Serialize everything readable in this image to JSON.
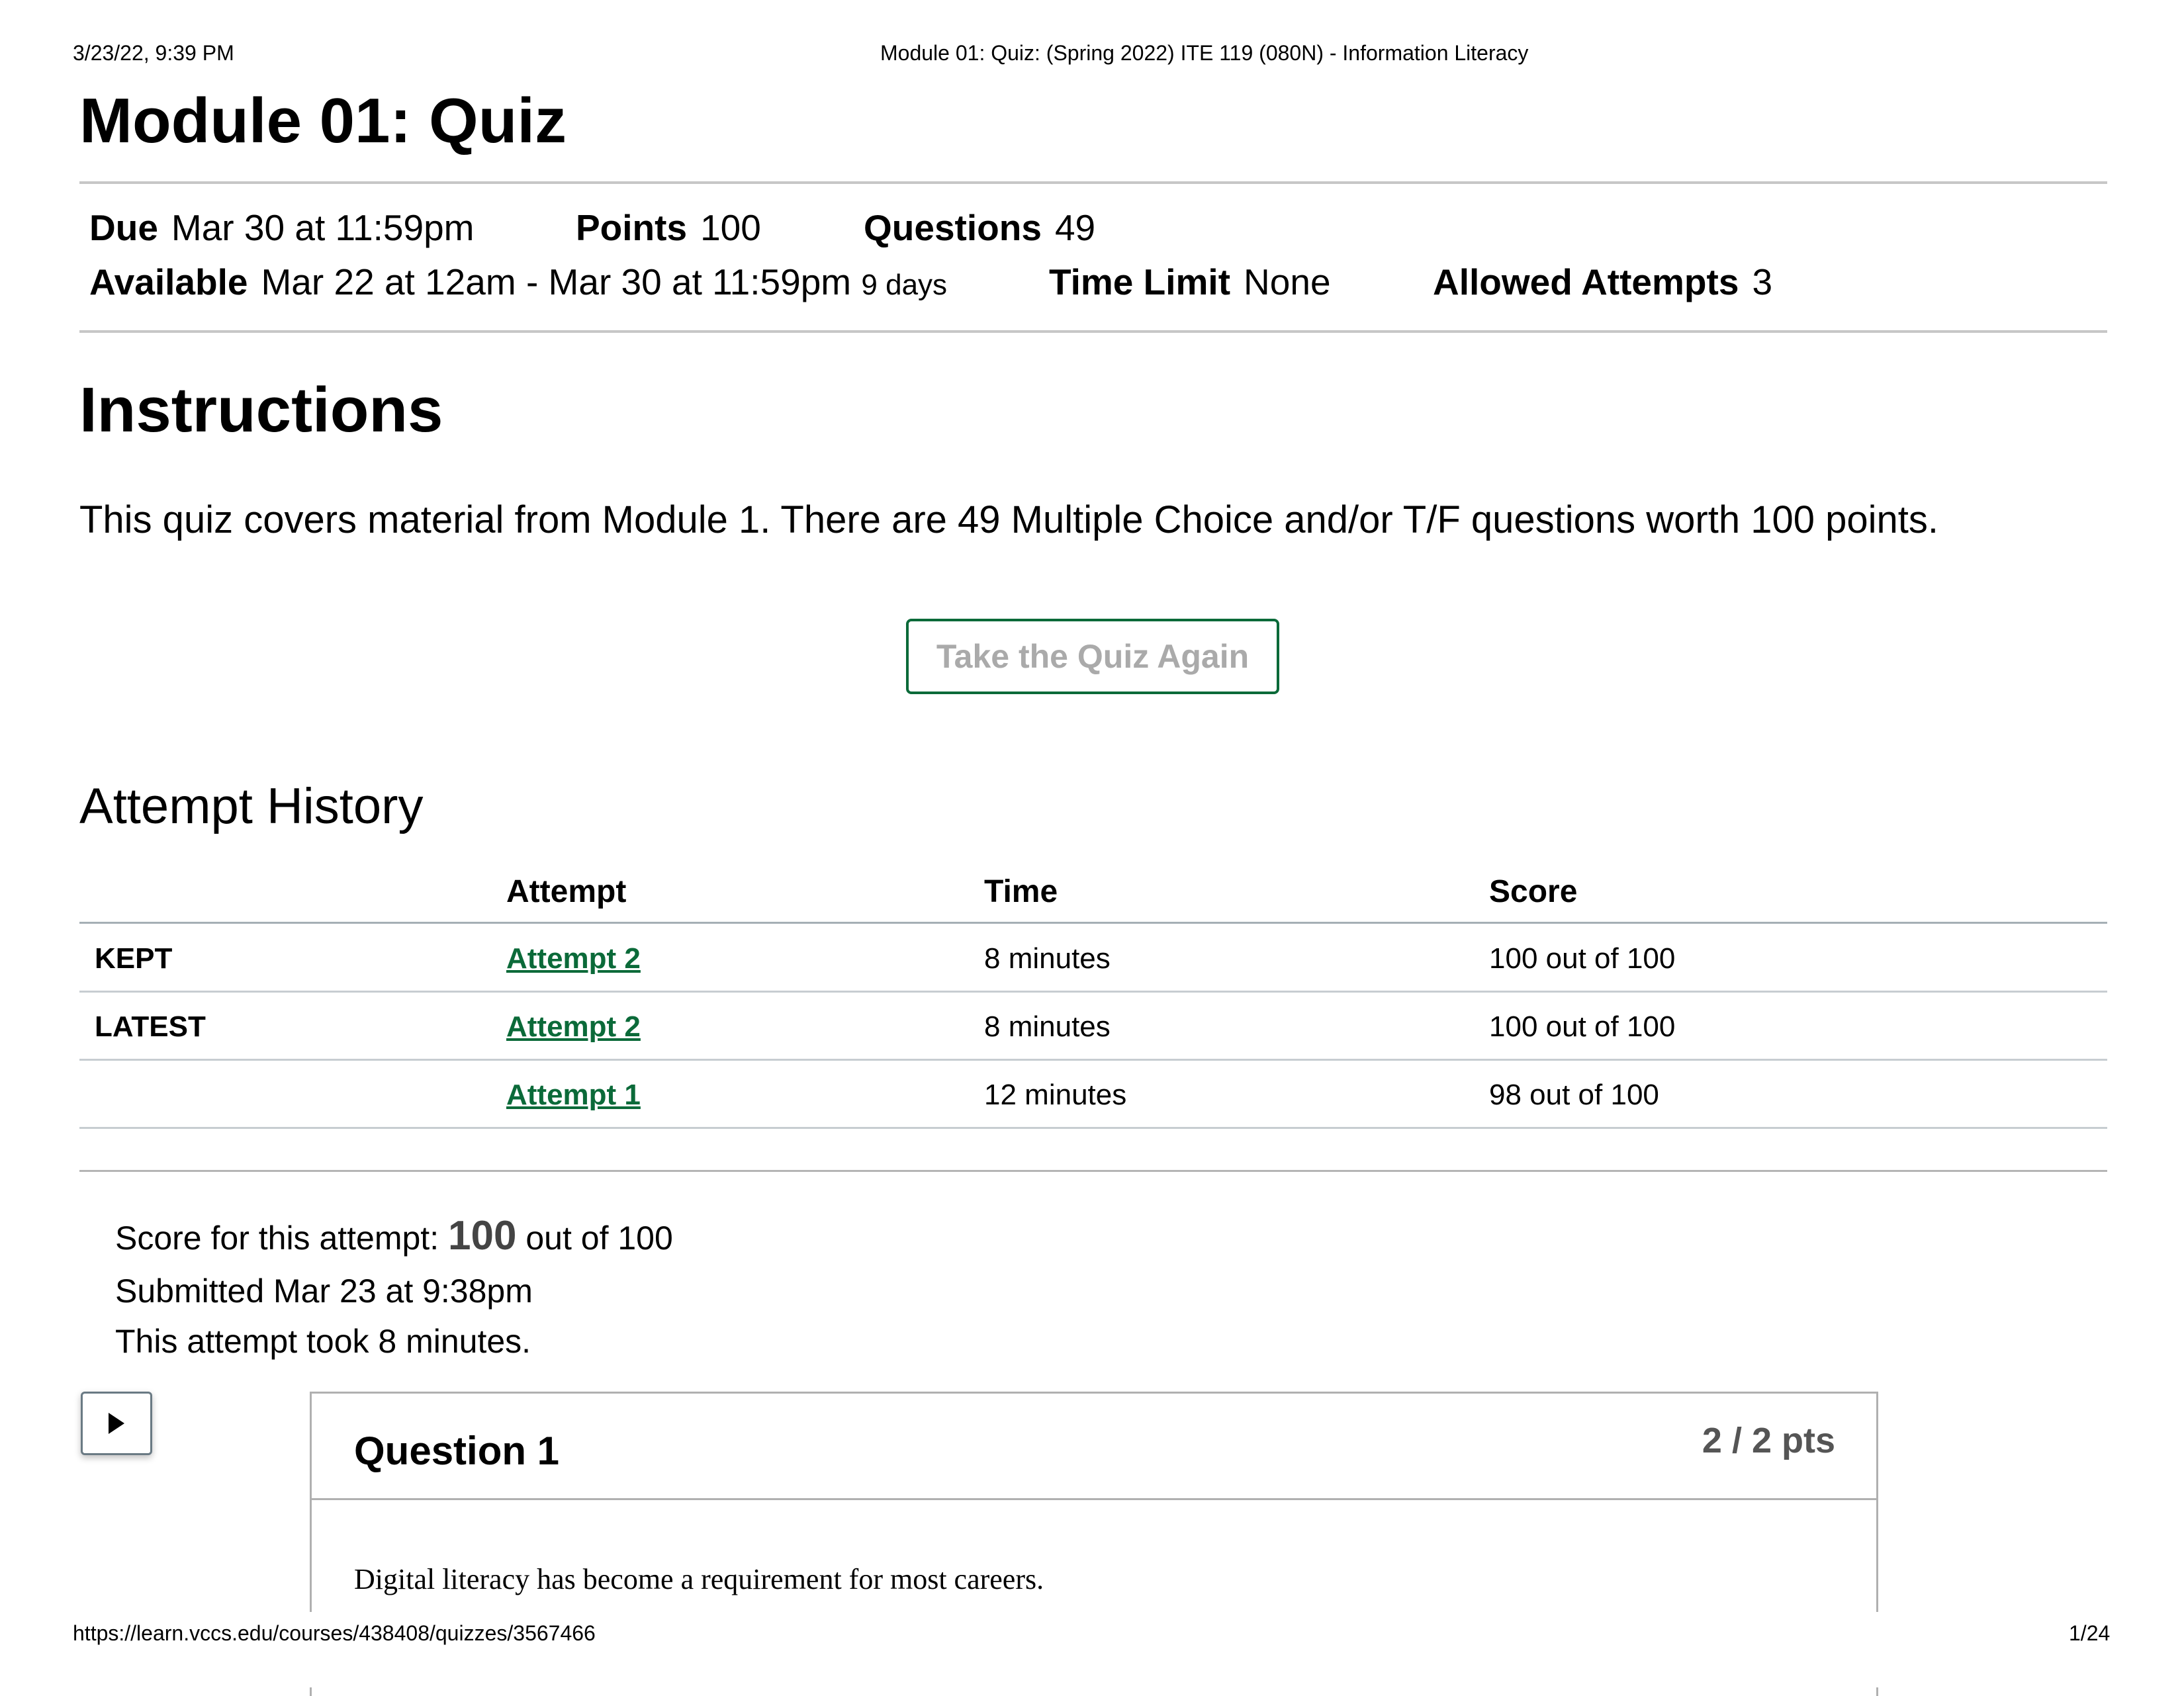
{
  "print_header": {
    "datetime": "3/23/22, 9:39 PM",
    "doc_title": "Module 01: Quiz: (Spring 2022) ITE 119 (080N) - Information Literacy"
  },
  "print_footer": {
    "url": "https://learn.vccs.edu/courses/438408/quizzes/3567466",
    "page": "1/24"
  },
  "quiz": {
    "title": "Module 01: Quiz",
    "details": {
      "due_label": "Due",
      "due_value": "Mar 30 at 11:59pm",
      "points_label": "Points",
      "points_value": "100",
      "questions_label": "Questions",
      "questions_value": "49",
      "available_label": "Available",
      "available_value": "Mar 22 at 12am - Mar 30 at 11:59pm",
      "available_duration": "9 days",
      "time_limit_label": "Time Limit",
      "time_limit_value": "None",
      "allowed_attempts_label": "Allowed Attempts",
      "allowed_attempts_value": "3"
    },
    "instructions_heading": "Instructions",
    "instructions_text": "This quiz covers material from Module 1. There are 49 Multiple Choice and/or T/F questions worth 100 points.",
    "retake_button": "Take the Quiz Again"
  },
  "attempt_history": {
    "heading": "Attempt History",
    "columns": [
      "",
      "Attempt",
      "Time",
      "Score"
    ],
    "rows": [
      {
        "label": "KEPT",
        "attempt": "Attempt 2",
        "time": "8 minutes",
        "score": "100 out of 100"
      },
      {
        "label": "LATEST",
        "attempt": "Attempt 2",
        "time": "8 minutes",
        "score": "100 out of 100"
      },
      {
        "label": "",
        "attempt": "Attempt 1",
        "time": "12 minutes",
        "score": "98 out of 100"
      }
    ]
  },
  "attempt_summary": {
    "score_prefix": "Score for this attempt:",
    "score_value": "100",
    "score_suffix": "out of 100",
    "submitted": "Submitted Mar 23 at 9:38pm",
    "duration": "This attempt took 8 minutes."
  },
  "question": {
    "toggle_icon": "play-triangle-icon",
    "title": "Question 1",
    "points": "2 / 2 pts",
    "text": "Digital literacy has become a requirement for most careers."
  },
  "colors": {
    "accent_green": "#0b6a39",
    "muted_text": "#aaaaaa",
    "rule_gray": "#c7c7c7"
  }
}
